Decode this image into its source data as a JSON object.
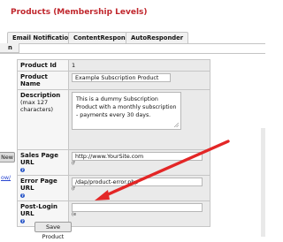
{
  "page_title": "Products (Membership Levels)",
  "tabs": [
    {
      "label": "Email Notifications"
    },
    {
      "label": "ContentResponder"
    },
    {
      "label": "AutoResponder"
    }
  ],
  "tab_overflow_label": "n",
  "form": {
    "product_id": {
      "label": "Product Id",
      "value": "1"
    },
    "product_name": {
      "label": "Product Name",
      "value": "Example Subscription Product"
    },
    "description": {
      "label": "Description",
      "note": "(max 127 characters)",
      "value": "This is a dummy Subscription Product with a monthly subscription - payments every 30 days."
    },
    "sales_page_url": {
      "label": "Sales Page URL",
      "value": "http://www.YourSite.com",
      "hint": "(f"
    },
    "error_page_url": {
      "label": "Error Page URL",
      "value": "/dap/product-error.php",
      "hint": "(f"
    },
    "post_login_url": {
      "label": "Post-Login URL",
      "value": "",
      "hint": "(e"
    }
  },
  "left_panel": {
    "new_button": "New",
    "link_text": "ow/"
  },
  "save_button": "Save Product",
  "colors": {
    "title": "#c0262c",
    "arrow": "#e32626",
    "help_icon": "#2a57c8"
  }
}
